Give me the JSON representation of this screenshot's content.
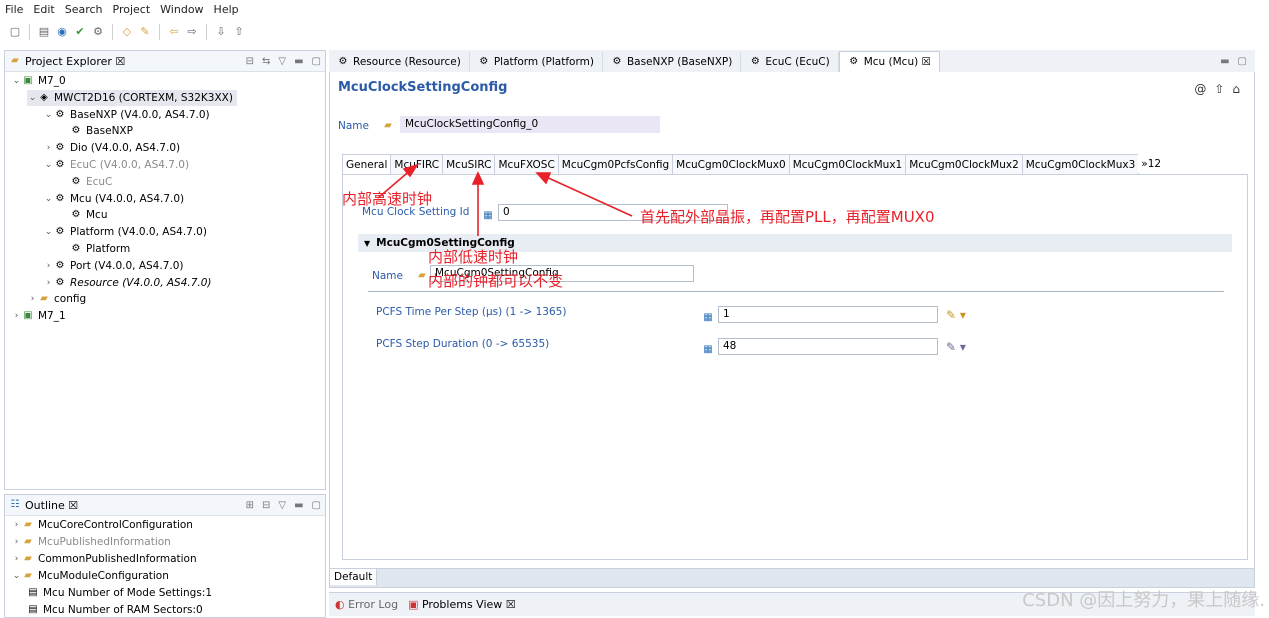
{
  "menu": [
    "File",
    "Edit",
    "Search",
    "Project",
    "Window",
    "Help"
  ],
  "project_explorer": {
    "title": "Project Explorer ☒",
    "items": [
      {
        "text": "M7_0",
        "indent": 0,
        "tw": "v",
        "icon": "project-icon"
      },
      {
        "text": "MWCT2D16 (CORTEXM, S32K3XX)",
        "indent": 1,
        "tw": "v",
        "icon": "chip-icon",
        "selected": true
      },
      {
        "text": "BaseNXP (V4.0.0, AS4.7.0)",
        "indent": 2,
        "tw": "v",
        "icon": "module-icon"
      },
      {
        "text": "BaseNXP",
        "indent": 3,
        "tw": "",
        "icon": "config-icon"
      },
      {
        "text": "Dio (V4.0.0, AS4.7.0)",
        "indent": 2,
        "tw": ">",
        "icon": "module-icon"
      },
      {
        "text": "EcuC (V4.0.0, AS4.7.0)",
        "indent": 2,
        "tw": "v",
        "icon": "module-icon",
        "grey": true
      },
      {
        "text": "EcuC",
        "indent": 3,
        "tw": "",
        "icon": "config-icon",
        "grey": true
      },
      {
        "text": "Mcu (V4.0.0, AS4.7.0)",
        "indent": 2,
        "tw": "v",
        "icon": "module-icon"
      },
      {
        "text": "Mcu",
        "indent": 3,
        "tw": "",
        "icon": "config-icon"
      },
      {
        "text": "Platform (V4.0.0, AS4.7.0)",
        "indent": 2,
        "tw": "v",
        "icon": "module-icon"
      },
      {
        "text": "Platform",
        "indent": 3,
        "tw": "",
        "icon": "config-icon"
      },
      {
        "text": "Port (V4.0.0, AS4.7.0)",
        "indent": 2,
        "tw": ">",
        "icon": "module-icon"
      },
      {
        "text": "Resource (V4.0.0, AS4.7.0)",
        "indent": 2,
        "tw": ">",
        "icon": "module-icon",
        "italic": true
      },
      {
        "text": "config",
        "indent": 1,
        "tw": ">",
        "icon": "folder-icon"
      },
      {
        "text": "M7_1",
        "indent": 0,
        "tw": ">",
        "icon": "project-icon"
      }
    ]
  },
  "outline": {
    "title": "Outline ☒",
    "items": [
      {
        "text": "McuCoreControlConfiguration",
        "tw": ">",
        "grey": false
      },
      {
        "text": "McuPublishedInformation",
        "tw": ">",
        "grey": true
      },
      {
        "text": "CommonPublishedInformation",
        "tw": ">",
        "grey": false
      },
      {
        "text": "McuModuleConfiguration",
        "tw": "v",
        "grey": false
      },
      {
        "text": "Mcu Number of Mode Settings:1",
        "tw": "",
        "grey": false,
        "leaf": true
      },
      {
        "text": "Mcu Number of RAM Sectors:0",
        "tw": "",
        "grey": false,
        "leaf": true
      }
    ]
  },
  "editor_tabs": [
    "Resource (Resource)",
    "Platform (Platform)",
    "BaseNXP (BaseNXP)",
    "EcuC (EcuC)",
    "Mcu (Mcu) ☒"
  ],
  "editor": {
    "title": "McuClockSettingConfig",
    "name_label": "Name",
    "name_value": "McuClockSettingConfig_0",
    "inner_tabs": [
      "General",
      "McuFIRC",
      "McuSIRC",
      "McuFXOSC",
      "McuCgm0PcfsConfig",
      "McuCgm0ClockMux0",
      "McuCgm0ClockMux1",
      "McuCgm0ClockMux2",
      "McuCgm0ClockMux3",
      "»12"
    ],
    "clock_id_label": "Mcu Clock Setting Id",
    "clock_id_value": "0",
    "section_title": "McuCgm0SettingConfig",
    "section_name_label": "Name",
    "section_name_value": "McuCgm0SettingConfig",
    "pcfs_time_label": "PCFS Time Per Step (µs) (1 -> 1365)",
    "pcfs_time_value": "1",
    "pcfs_dur_label": "PCFS Step Duration (0 -> 65535)",
    "pcfs_dur_value": "48",
    "default_tab": "Default"
  },
  "annotations": {
    "firc": "内部高速时钟",
    "sirc": "内部低速时钟",
    "internal": "内部的钟都可以不变",
    "fxosc": "首先配外部晶振，再配置PLL，再配置MUX0"
  },
  "bottom_tabs": [
    "Error Log",
    "Problems View ☒"
  ],
  "watermark": "CSDN @因上努力，果上随缘."
}
